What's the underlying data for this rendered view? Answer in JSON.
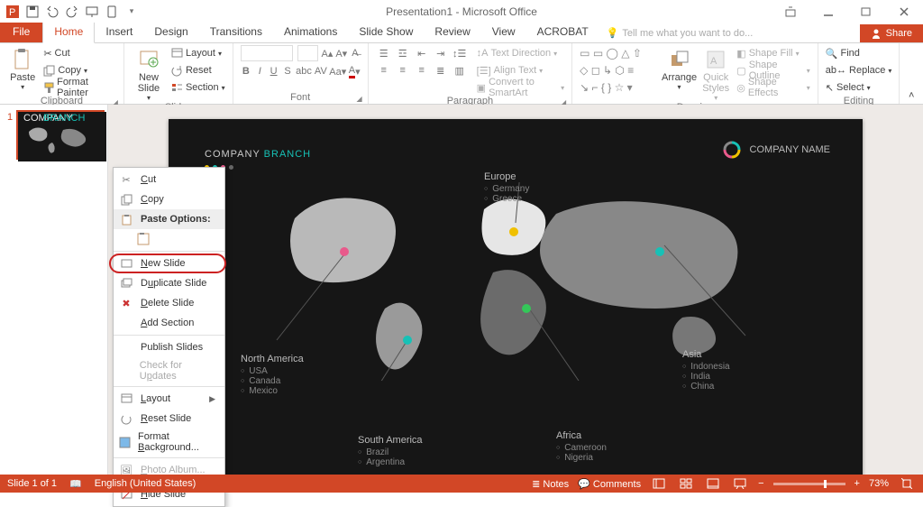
{
  "title": "Presentation1 - Microsoft Office",
  "tabs": {
    "file": "File",
    "home": "Home",
    "insert": "Insert",
    "design": "Design",
    "transitions": "Transitions",
    "animations": "Animations",
    "slideshow": "Slide Show",
    "review": "Review",
    "view": "View",
    "acrobat": "ACROBAT",
    "tell": "Tell me what you want to do...",
    "share": "Share"
  },
  "ribbon": {
    "clipboard": {
      "label": "Clipboard",
      "paste": "Paste",
      "cut": "Cut",
      "copy": "Copy",
      "fmt": "Format Painter"
    },
    "slides": {
      "label": "Slides",
      "new": "New\nSlide",
      "layout": "Layout",
      "reset": "Reset",
      "section": "Section"
    },
    "font": {
      "label": "Font"
    },
    "paragraph": {
      "label": "Paragraph",
      "textdir": "Text Direction",
      "align": "Align Text",
      "smart": "Convert to SmartArt"
    },
    "drawing": {
      "label": "Drawing",
      "arrange": "Arrange",
      "quick": "Quick\nStyles",
      "fill": "Shape Fill",
      "outline": "Shape Outline",
      "effects": "Shape Effects"
    },
    "editing": {
      "label": "Editing",
      "find": "Find",
      "replace": "Replace",
      "select": "Select"
    }
  },
  "context_menu": {
    "cut": "Cut",
    "copy": "Copy",
    "paste_opts": "Paste Options:",
    "new": "New Slide",
    "dup": "Duplicate Slide",
    "del": "Delete Slide",
    "section": "Add Section",
    "publish": "Publish Slides",
    "updates": "Check for Updates",
    "layout": "Layout",
    "reset": "Reset Slide",
    "fmtbg": "Format Background...",
    "photo": "Photo Album...",
    "hide": "Hide Slide"
  },
  "slide": {
    "title1": "COMPANY ",
    "title2": "BRANCH",
    "company": "COMPANY NAME",
    "regions": {
      "na": {
        "name": "North America",
        "items": [
          "USA",
          "Canada",
          "Mexico"
        ]
      },
      "sa": {
        "name": "South America",
        "items": [
          "Brazil",
          "Argentina"
        ]
      },
      "eu": {
        "name": "Europe",
        "items": [
          "Germany",
          "Greece"
        ]
      },
      "af": {
        "name": "Africa",
        "items": [
          "Cameroon",
          "Nigeria"
        ]
      },
      "as": {
        "name": "Asia",
        "items": [
          "Indonesia",
          "India",
          "China"
        ]
      }
    }
  },
  "status": {
    "slide": "Slide 1 of 1",
    "lang": "English (United States)",
    "notes": "Notes",
    "comments": "Comments",
    "zoom": "73%"
  }
}
